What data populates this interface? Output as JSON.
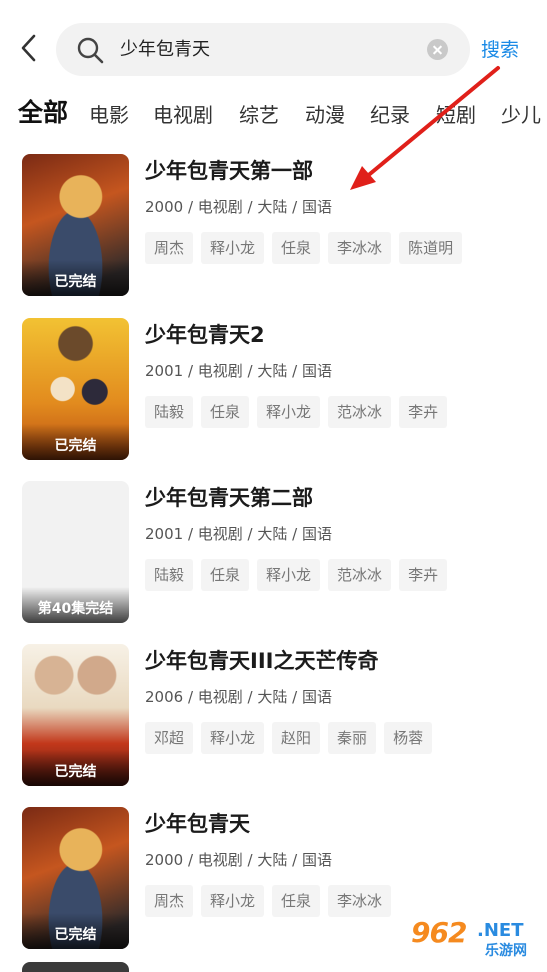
{
  "search": {
    "query": "少年包青天",
    "button_label": "搜索"
  },
  "tabs": [
    "全部",
    "电影",
    "电视剧",
    "综艺",
    "动漫",
    "纪录",
    "短剧",
    "少儿"
  ],
  "results": [
    {
      "title": "少年包青天第一部",
      "meta": "2000 / 电视剧 / 大陆 / 国语",
      "status": "已完结",
      "cast": [
        "周杰",
        "释小龙",
        "任泉",
        "李冰冰",
        "陈道明"
      ]
    },
    {
      "title": "少年包青天2",
      "meta": "2001 / 电视剧 / 大陆 / 国语",
      "status": "已完结",
      "cast": [
        "陆毅",
        "任泉",
        "释小龙",
        "范冰冰",
        "李卉"
      ]
    },
    {
      "title": "少年包青天第二部",
      "meta": "2001 / 电视剧 / 大陆 / 国语",
      "status": "第40集完结",
      "cast": [
        "陆毅",
        "任泉",
        "释小龙",
        "范冰冰",
        "李卉"
      ]
    },
    {
      "title": "少年包青天III之天芒传奇",
      "meta": "2006 / 电视剧 / 大陆 / 国语",
      "status": "已完结",
      "cast": [
        "邓超",
        "释小龙",
        "赵阳",
        "秦丽",
        "杨蓉"
      ]
    },
    {
      "title": "少年包青天",
      "meta": "2000 / 电视剧 / 大陆 / 国语",
      "status": "已完结",
      "cast": [
        "周杰",
        "释小龙",
        "任泉",
        "李冰冰"
      ]
    }
  ],
  "watermark": {
    "number": "962",
    "suffix": ".NET",
    "site": "乐游网"
  }
}
